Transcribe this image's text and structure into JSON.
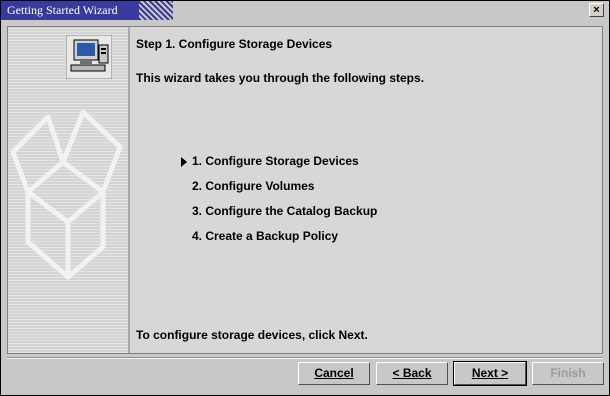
{
  "window": {
    "title": "Getting Started Wizard",
    "close_glyph": "×"
  },
  "step": {
    "title": "Step 1.  Configure Storage Devices",
    "intro": "This wizard takes you through the following steps.",
    "items": [
      {
        "label": "1.  Configure Storage Devices",
        "current": true
      },
      {
        "label": "2.  Configure Volumes",
        "current": false
      },
      {
        "label": "3.  Configure the Catalog Backup",
        "current": false
      },
      {
        "label": "4.  Create a Backup Policy",
        "current": false
      }
    ],
    "footer": "To configure storage devices, click Next."
  },
  "buttons": {
    "cancel": "Cancel",
    "back": "< Back",
    "next": "Next >",
    "finish": "Finish"
  },
  "icons": {
    "header": "computer-icon",
    "watermark": "box-watermark-icon"
  },
  "colors": {
    "titlebar": "#3a3a9e",
    "background": "#c8c8c8",
    "disabled_text": "#9a9a9a"
  }
}
